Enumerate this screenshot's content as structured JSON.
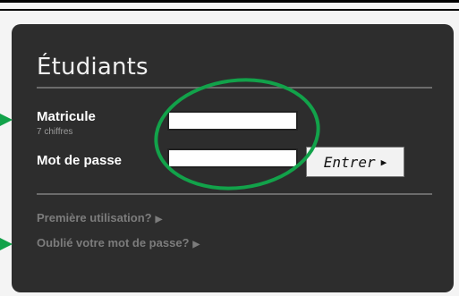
{
  "header": {
    "title": "Étudiants"
  },
  "form": {
    "matricule_label": "Matricule",
    "matricule_hint": "7 chiffres",
    "matricule_value": "",
    "password_label": "Mot de passe",
    "password_value": "",
    "submit_label": "Entrer"
  },
  "links": {
    "first_use": "Première utilisation?",
    "forgot_password": "Oublié votre mot de passe?"
  },
  "colors": {
    "panel_bg": "#2d2d2d",
    "highlight_green": "#12a24a"
  },
  "icons": {
    "submit_arrow": "triangle-right",
    "link_arrow": "triangle-right"
  }
}
